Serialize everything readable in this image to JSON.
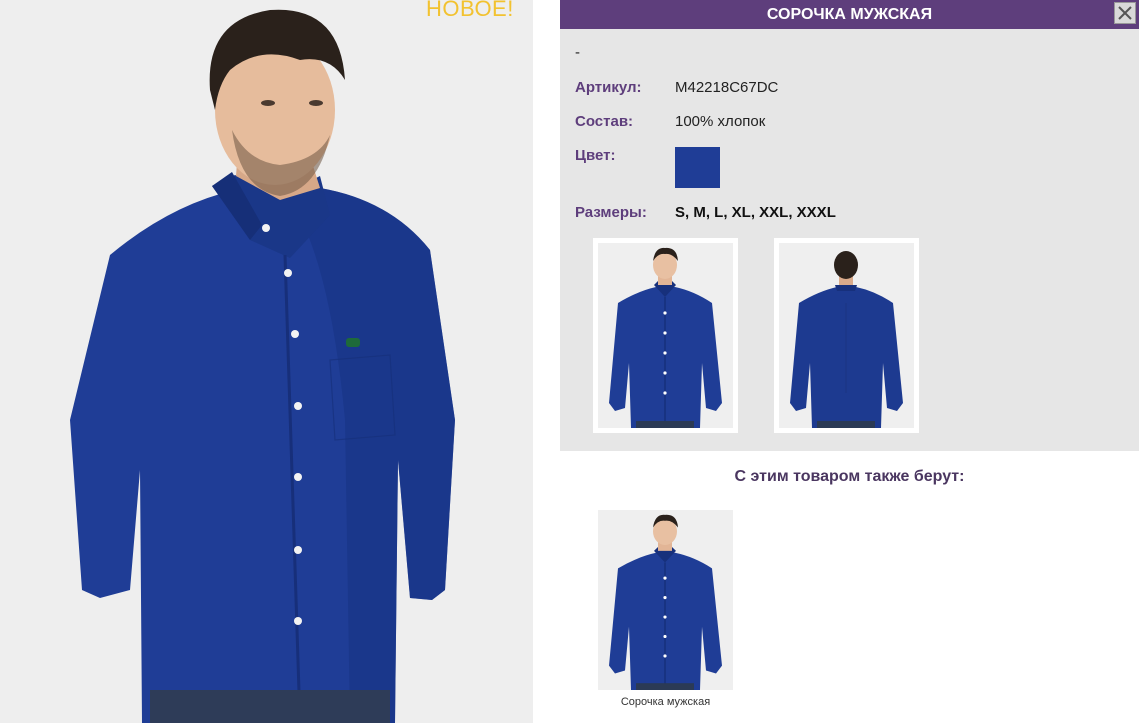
{
  "badge": "НОВОЕ!",
  "header": {
    "title": "СОРОЧКА МУЖСКАЯ"
  },
  "description": "-",
  "fields": {
    "article_label": "Артикул:",
    "article_value": "M42218C67DC",
    "composition_label": "Состав:",
    "composition_value": "100% хлопок",
    "color_label": "Цвет:",
    "color_value": "#1f3d96",
    "sizes_label": "Размеры:",
    "sizes_value": "S, M, L, XL, XXL, XXXL"
  },
  "related": {
    "title": "С этим товаром также берут:",
    "items": [
      {
        "caption": "Сорочка мужская"
      }
    ]
  },
  "colors": {
    "accent": "#5e3e7c",
    "shirt": "#1f3d96",
    "badge": "#f2c230"
  },
  "icons": {
    "close": "close-icon"
  }
}
